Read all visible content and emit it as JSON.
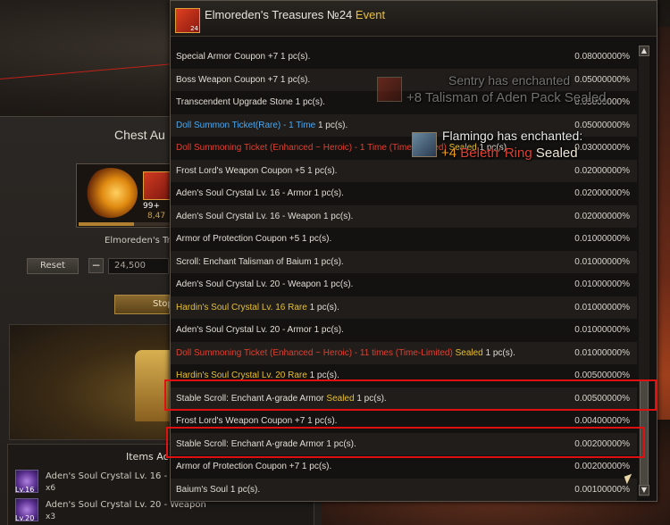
{
  "left_panel": {
    "title": "Chest Au",
    "chest_qty": "99+",
    "chest_count": "8,47",
    "chest_name": "Elmoreden's Tre",
    "reset_label": "Reset",
    "minus_label": "−",
    "quantity_value": "24,500",
    "stop_label": "Stop",
    "items_title": "Items Ac",
    "acquired": [
      {
        "level": "Lv.16",
        "name": "Aden's Soul Crystal Lv. 16 - Wea",
        "qty": "x6"
      },
      {
        "level": "Lv.20",
        "name": "Aden's Soul Crystal Lv. 20 - Weapon",
        "qty": "x3"
      }
    ]
  },
  "popup": {
    "icon_number": "24",
    "title": "Elmoreden's Treasures №24",
    "title_tag": "Event",
    "rows": [
      {
        "name": "Special Armor Coupon +7",
        "qty": "1 pc(s).",
        "pct": "0.08000000%",
        "color": "white"
      },
      {
        "name": "Boss Weapon Coupon +7",
        "qty": "1 pc(s).",
        "pct": "0.05000000%",
        "color": "white"
      },
      {
        "name": "Transcendent Upgrade Stone",
        "qty": "1 pc(s).",
        "pct": "0.05000000%",
        "color": "white"
      },
      {
        "name": "Doll Summon Ticket(Rare) - 1 Time",
        "qty": "1 pc(s).",
        "pct": "0.05000000%",
        "color": "blue"
      },
      {
        "name": "Doll Summoning Ticket (Enhanced ~ Heroic) - 1 Time (Time-Limited)",
        "sealed": "Sealed",
        "qty": "1 pc(s).",
        "pct": "0.03000000%",
        "color": "red"
      },
      {
        "name": "Frost Lord's Weapon Coupon +5",
        "qty": "1 pc(s).",
        "pct": "0.02000000%",
        "color": "white"
      },
      {
        "name": "Aden's Soul Crystal Lv. 16 - Armor",
        "qty": "1 pc(s).",
        "pct": "0.02000000%",
        "color": "white"
      },
      {
        "name": "Aden's Soul Crystal Lv. 16 - Weapon",
        "qty": "1 pc(s).",
        "pct": "0.02000000%",
        "color": "white"
      },
      {
        "name": "Armor of Protection Coupon +5",
        "qty": "1 pc(s).",
        "pct": "0.01000000%",
        "color": "white"
      },
      {
        "name": "Scroll: Enchant Talisman of Baium",
        "qty": "1 pc(s).",
        "pct": "0.01000000%",
        "color": "white"
      },
      {
        "name": "Aden's Soul Crystal Lv. 20 - Weapon",
        "qty": "1 pc(s).",
        "pct": "0.01000000%",
        "color": "white"
      },
      {
        "name": "Hardin's Soul Crystal Lv. 16 Rare",
        "qty": "1 pc(s).",
        "pct": "0.01000000%",
        "color": "yellow"
      },
      {
        "name": "Aden's Soul Crystal Lv. 20 - Armor",
        "qty": "1 pc(s).",
        "pct": "0.01000000%",
        "color": "white"
      },
      {
        "name": "Doll Summoning Ticket (Enhanced ~ Heroic) - 11 times (Time-Limited)",
        "sealed": "Sealed",
        "qty": "1 pc(s).",
        "pct": "0.01000000%",
        "color": "red"
      },
      {
        "name": "Hardin's Soul Crystal Lv. 20 Rare",
        "qty": "1 pc(s).",
        "pct": "0.00500000%",
        "color": "yellow"
      },
      {
        "name": "Stable Scroll: Enchant A-grade Armor",
        "sealed": "Sealed",
        "qty": "1 pc(s).",
        "pct": "0.00500000%",
        "color": "white"
      },
      {
        "name": "Frost Lord's Weapon Coupon +7",
        "qty": "1 pc(s).",
        "pct": "0.00400000%",
        "color": "white"
      },
      {
        "name": "Stable Scroll: Enchant A-grade Armor",
        "qty": "1 pc(s).",
        "pct": "0.00200000%",
        "color": "white"
      },
      {
        "name": "Armor of Protection Coupon +7",
        "qty": "1 pc(s).",
        "pct": "0.00200000%",
        "color": "white"
      },
      {
        "name": "Baium's Soul",
        "qty": "1 pc(s).",
        "pct": "0.00100000%",
        "color": "white"
      }
    ]
  },
  "notices": {
    "n1_line1": "Sentry has enchanted",
    "n1_line2": "+8 Talisman of Aden Pack Sealed",
    "n2_line1": "Flamingo has enchanted:",
    "n2_plus": "+4",
    "n2_item": "Beleth' Ring",
    "n2_sealed": "Sealed"
  },
  "scroll": {
    "up": "▲",
    "down": "▼"
  }
}
